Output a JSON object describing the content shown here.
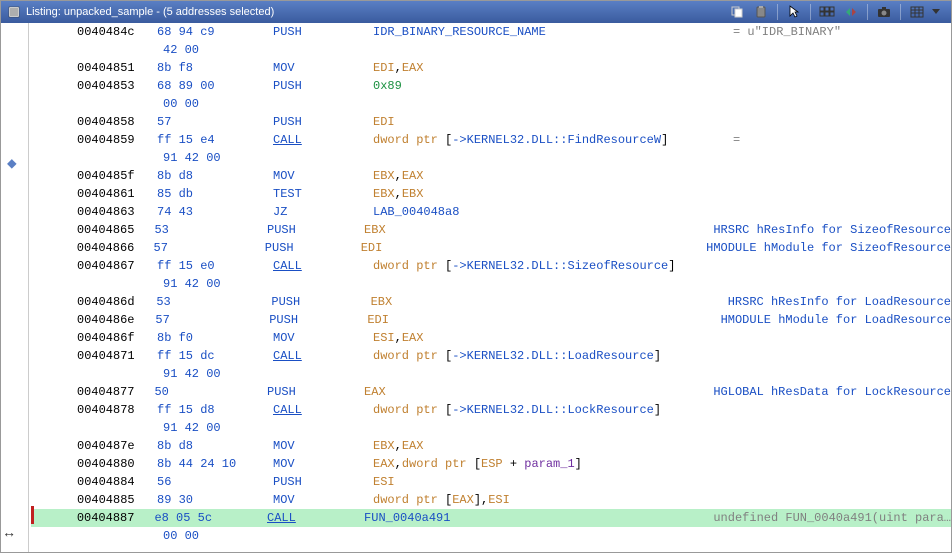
{
  "header": {
    "title": "Listing:  unpacked_sample - (5 addresses selected)"
  },
  "rows": [
    {
      "addr": "0040484c",
      "bytes": "68 94 c9",
      "mnem": "PUSH",
      "ops": [
        {
          "t": "IDR_BINARY_RESOURCE_NAME",
          "c": "c-lab"
        }
      ],
      "cmt": "= u\"IDR_BINARY\"",
      "cmtCls": "c-cmt"
    },
    {
      "addr": "",
      "bytes": "42 00",
      "mnem": "",
      "ops": [],
      "cont": true
    },
    {
      "addr": "00404851",
      "bytes": "8b f8",
      "mnem": "MOV",
      "ops": [
        {
          "t": "EDI",
          "c": "c-reg"
        },
        {
          "t": ",",
          "c": "c-addr"
        },
        {
          "t": "EAX",
          "c": "c-reg"
        }
      ]
    },
    {
      "addr": "00404853",
      "bytes": "68 89 00",
      "mnem": "PUSH",
      "ops": [
        {
          "t": "0x89",
          "c": "c-lit"
        }
      ]
    },
    {
      "addr": "",
      "bytes": "00 00",
      "mnem": "",
      "ops": [],
      "cont": true
    },
    {
      "addr": "00404858",
      "bytes": "57",
      "mnem": "PUSH",
      "ops": [
        {
          "t": "EDI",
          "c": "c-reg"
        }
      ]
    },
    {
      "addr": "00404859",
      "bytes": "ff 15 e4",
      "mnem": "CALL",
      "mnemUnderline": true,
      "ops": [
        {
          "t": "dword ptr ",
          "c": "c-reg"
        },
        {
          "t": "[",
          "c": "c-addr"
        },
        {
          "t": "->KERNEL32.DLL::FindResourceW",
          "c": "c-mem"
        },
        {
          "t": "]",
          "c": "c-addr"
        }
      ],
      "cmt": "=",
      "cmtCls": "c-cmt"
    },
    {
      "addr": "",
      "bytes": "91 42 00",
      "mnem": "",
      "ops": [],
      "cont": true
    },
    {
      "addr": "0040485f",
      "bytes": "8b d8",
      "mnem": "MOV",
      "ops": [
        {
          "t": "EBX",
          "c": "c-reg"
        },
        {
          "t": ",",
          "c": "c-addr"
        },
        {
          "t": "EAX",
          "c": "c-reg"
        }
      ]
    },
    {
      "addr": "00404861",
      "bytes": "85 db",
      "mnem": "TEST",
      "ops": [
        {
          "t": "EBX",
          "c": "c-reg"
        },
        {
          "t": ",",
          "c": "c-addr"
        },
        {
          "t": "EBX",
          "c": "c-reg"
        }
      ]
    },
    {
      "addr": "00404863",
      "bytes": "74 43",
      "mnem": "JZ",
      "ops": [
        {
          "t": "LAB_004048a8",
          "c": "c-lab"
        }
      ]
    },
    {
      "addr": "00404865",
      "bytes": "53",
      "mnem": "PUSH",
      "ops": [
        {
          "t": "EBX",
          "c": "c-reg"
        }
      ],
      "cmt": "HRSRC hResInfo for SizeofResource",
      "cmtCls": "c-cmtb"
    },
    {
      "addr": "00404866",
      "bytes": "57",
      "mnem": "PUSH",
      "ops": [
        {
          "t": "EDI",
          "c": "c-reg"
        }
      ],
      "cmt": "HMODULE hModule for SizeofResource",
      "cmtCls": "c-cmtb"
    },
    {
      "addr": "00404867",
      "bytes": "ff 15 e0",
      "mnem": "CALL",
      "mnemUnderline": true,
      "ops": [
        {
          "t": "dword ptr ",
          "c": "c-reg"
        },
        {
          "t": "[",
          "c": "c-addr"
        },
        {
          "t": "->KERNEL32.DLL::SizeofResource",
          "c": "c-mem"
        },
        {
          "t": "]",
          "c": "c-addr"
        }
      ]
    },
    {
      "addr": "",
      "bytes": "91 42 00",
      "mnem": "",
      "ops": [],
      "cont": true
    },
    {
      "addr": "0040486d",
      "bytes": "53",
      "mnem": "PUSH",
      "ops": [
        {
          "t": "EBX",
          "c": "c-reg"
        }
      ],
      "cmt": "HRSRC hResInfo for LoadResource",
      "cmtCls": "c-cmtb"
    },
    {
      "addr": "0040486e",
      "bytes": "57",
      "mnem": "PUSH",
      "ops": [
        {
          "t": "EDI",
          "c": "c-reg"
        }
      ],
      "cmt": "HMODULE hModule for LoadResource",
      "cmtCls": "c-cmtb"
    },
    {
      "addr": "0040486f",
      "bytes": "8b f0",
      "mnem": "MOV",
      "ops": [
        {
          "t": "ESI",
          "c": "c-reg"
        },
        {
          "t": ",",
          "c": "c-addr"
        },
        {
          "t": "EAX",
          "c": "c-reg"
        }
      ]
    },
    {
      "addr": "00404871",
      "bytes": "ff 15 dc",
      "mnem": "CALL",
      "mnemUnderline": true,
      "ops": [
        {
          "t": "dword ptr ",
          "c": "c-reg"
        },
        {
          "t": "[",
          "c": "c-addr"
        },
        {
          "t": "->KERNEL32.DLL::LoadResource",
          "c": "c-mem"
        },
        {
          "t": "]",
          "c": "c-addr"
        }
      ]
    },
    {
      "addr": "",
      "bytes": "91 42 00",
      "mnem": "",
      "ops": [],
      "cont": true
    },
    {
      "addr": "00404877",
      "bytes": "50",
      "mnem": "PUSH",
      "ops": [
        {
          "t": "EAX",
          "c": "c-reg"
        }
      ],
      "cmt": "HGLOBAL hResData for LockResource",
      "cmtCls": "c-cmtb"
    },
    {
      "addr": "00404878",
      "bytes": "ff 15 d8",
      "mnem": "CALL",
      "mnemUnderline": true,
      "ops": [
        {
          "t": "dword ptr ",
          "c": "c-reg"
        },
        {
          "t": "[",
          "c": "c-addr"
        },
        {
          "t": "->KERNEL32.DLL::LockResource",
          "c": "c-mem"
        },
        {
          "t": "]",
          "c": "c-addr"
        }
      ]
    },
    {
      "addr": "",
      "bytes": "91 42 00",
      "mnem": "",
      "ops": [],
      "cont": true
    },
    {
      "addr": "0040487e",
      "bytes": "8b d8",
      "mnem": "MOV",
      "ops": [
        {
          "t": "EBX",
          "c": "c-reg"
        },
        {
          "t": ",",
          "c": "c-addr"
        },
        {
          "t": "EAX",
          "c": "c-reg"
        }
      ]
    },
    {
      "addr": "00404880",
      "bytes": "8b 44 24 10",
      "mnem": "MOV",
      "ops": [
        {
          "t": "EAX",
          "c": "c-reg"
        },
        {
          "t": ",",
          "c": "c-addr"
        },
        {
          "t": "dword ptr ",
          "c": "c-reg"
        },
        {
          "t": "[",
          "c": "c-addr"
        },
        {
          "t": "ESP",
          "c": "c-reg"
        },
        {
          "t": " + ",
          "c": "c-addr"
        },
        {
          "t": "param_1",
          "c": "c-par"
        },
        {
          "t": "]",
          "c": "c-addr"
        }
      ]
    },
    {
      "addr": "00404884",
      "bytes": "56",
      "mnem": "PUSH",
      "ops": [
        {
          "t": "ESI",
          "c": "c-reg"
        }
      ]
    },
    {
      "addr": "00404885",
      "bytes": "89 30",
      "mnem": "MOV",
      "ops": [
        {
          "t": "dword ptr ",
          "c": "c-reg"
        },
        {
          "t": "[",
          "c": "c-addr"
        },
        {
          "t": "EAX",
          "c": "c-reg"
        },
        {
          "t": "],",
          "c": "c-addr"
        },
        {
          "t": "ESI",
          "c": "c-reg"
        }
      ]
    },
    {
      "addr": "00404887",
      "bytes": "e8 05 5c",
      "mnem": "CALL",
      "mnemUnderline": true,
      "ops": [
        {
          "t": "FUN_0040a491",
          "c": "c-fun"
        }
      ],
      "cmt": "undefined FUN_0040a491(uint para…",
      "cmtCls": "c-cmt",
      "sel": true
    },
    {
      "addr": "",
      "bytes": "00 00",
      "mnem": "",
      "ops": [],
      "cont": true,
      "sel": false
    }
  ]
}
